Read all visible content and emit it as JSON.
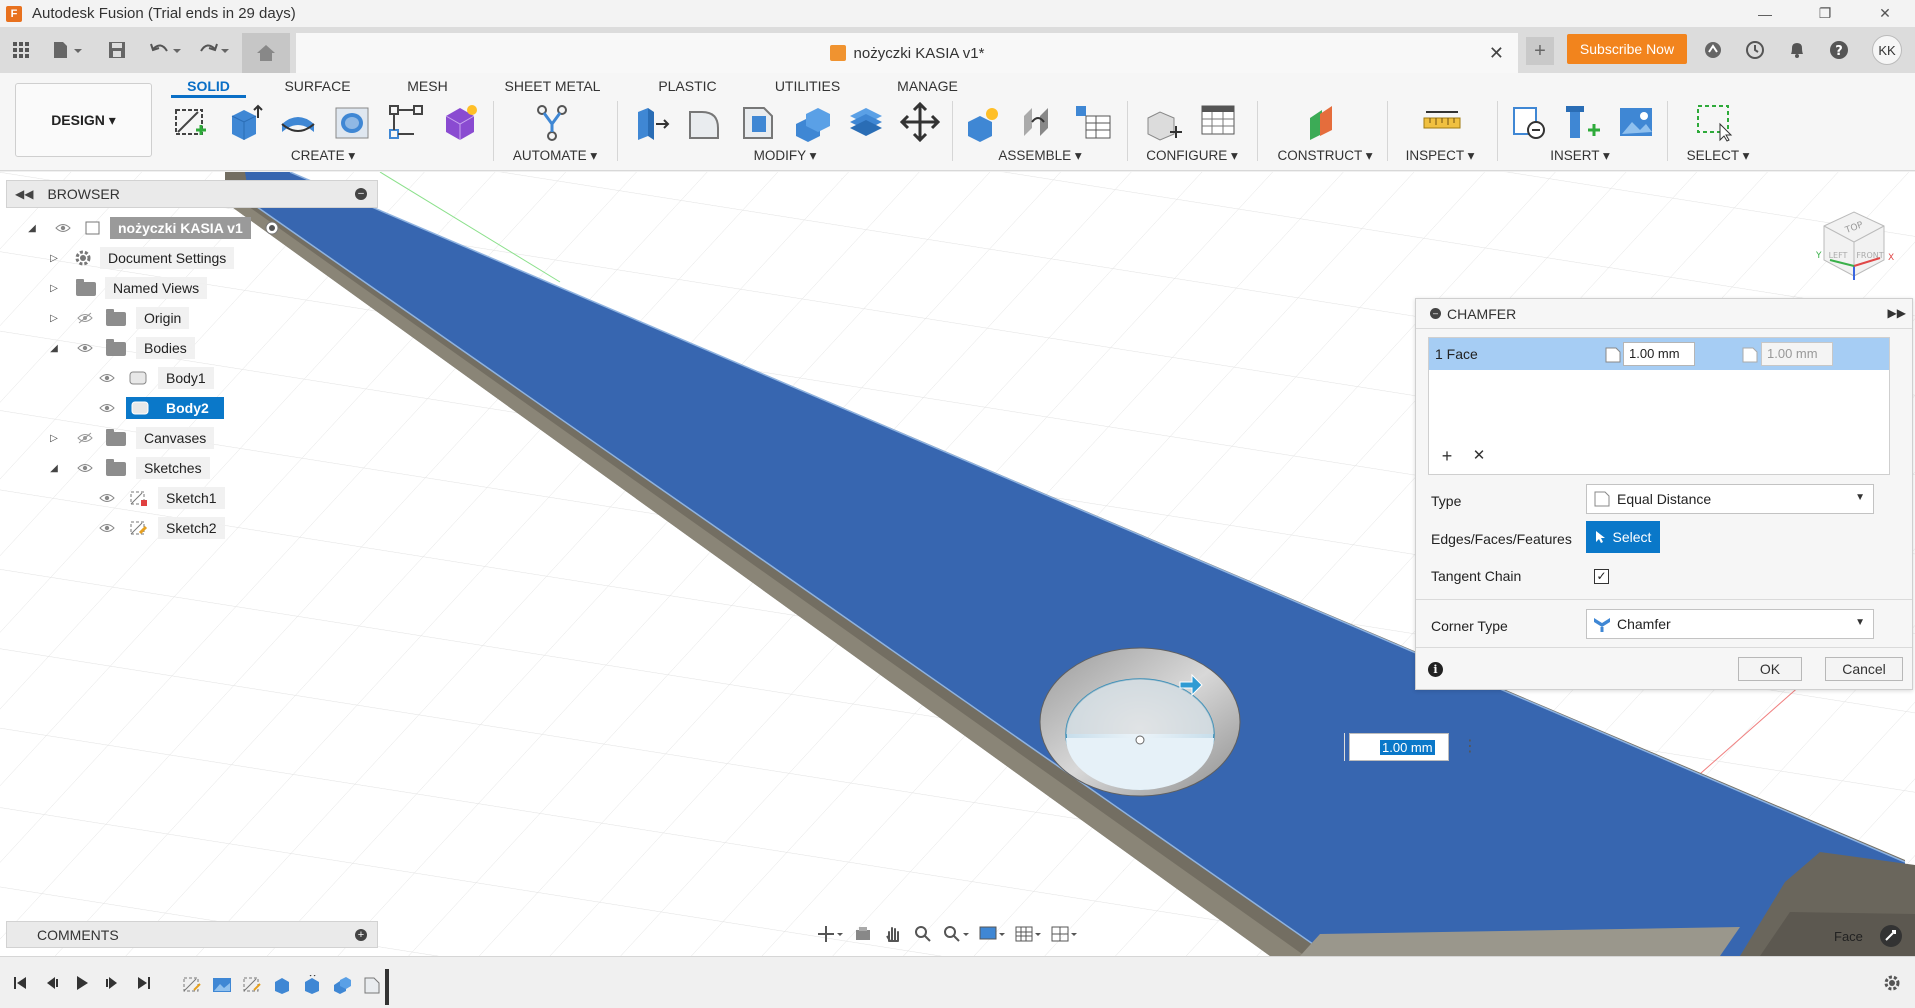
{
  "window": {
    "title": "Autodesk Fusion (Trial ends in 29 days)",
    "logo_letter": "F"
  },
  "document": {
    "tab_title": "nożyczki KASIA v1*"
  },
  "header": {
    "subscribe_label": "Subscribe Now",
    "user_initials": "KK"
  },
  "toolbar": {
    "workspace_label": "DESIGN",
    "tabs": [
      "SOLID",
      "SURFACE",
      "MESH",
      "SHEET METAL",
      "PLASTIC",
      "UTILITIES",
      "MANAGE"
    ],
    "active_tab": "SOLID",
    "groups": [
      "CREATE",
      "AUTOMATE",
      "MODIFY",
      "ASSEMBLE",
      "CONFIGURE",
      "CONSTRUCT",
      "INSPECT",
      "INSERT",
      "SELECT"
    ]
  },
  "browser": {
    "title": "BROWSER",
    "root": "nożyczki KASIA v1",
    "items": [
      {
        "label": "Document Settings"
      },
      {
        "label": "Named Views"
      },
      {
        "label": "Origin"
      },
      {
        "label": "Bodies"
      },
      {
        "label": "Body1"
      },
      {
        "label": "Body2"
      },
      {
        "label": "Canvases"
      },
      {
        "label": "Sketches"
      },
      {
        "label": "Sketch1"
      },
      {
        "label": "Sketch2"
      }
    ]
  },
  "comments": {
    "title": "COMMENTS"
  },
  "chamfer": {
    "title": "CHAMFER",
    "selection_label": "1 Face",
    "distance1": "1.00 mm",
    "distance2": "1.00 mm",
    "type_label": "Type",
    "type_value": "Equal Distance",
    "edges_label": "Edges/Faces/Features",
    "select_label": "Select",
    "tangent_label": "Tangent Chain",
    "tangent_checked": true,
    "corner_label": "Corner Type",
    "corner_value": "Chamfer",
    "ok_label": "OK",
    "cancel_label": "Cancel"
  },
  "canvas": {
    "dimension_value": "1.00 mm",
    "selection_hint": "Face"
  },
  "colors": {
    "accent": "#0a78c9",
    "body_face": "#3766b0",
    "subscribe": "#f2841d"
  }
}
